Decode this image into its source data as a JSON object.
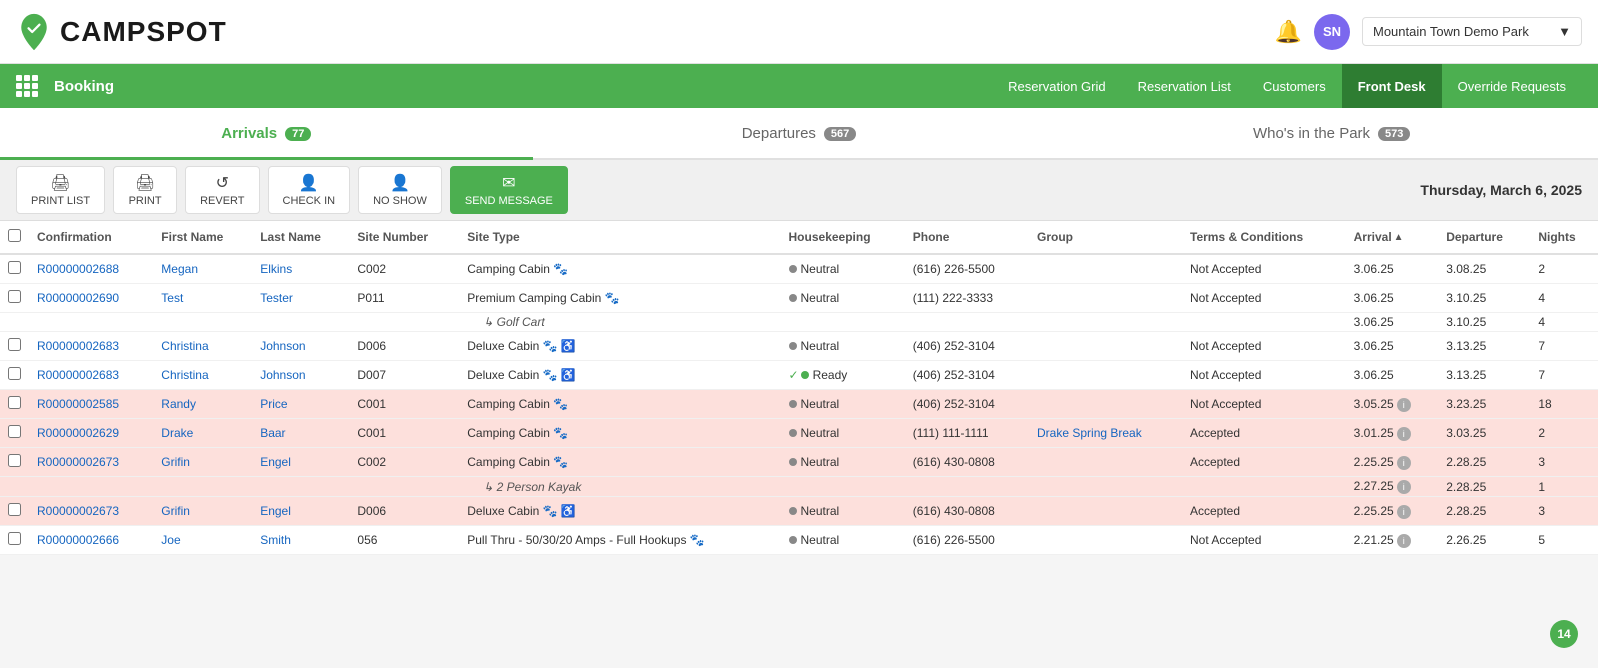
{
  "app": {
    "logo_text": "CAMPSPOT",
    "park_name": "Mountain Town Demo Park"
  },
  "nav": {
    "booking_label": "Booking",
    "links": [
      {
        "id": "reservation-grid",
        "label": "Reservation Grid"
      },
      {
        "id": "reservation-list",
        "label": "Reservation List"
      },
      {
        "id": "customers",
        "label": "Customers"
      },
      {
        "id": "front-desk",
        "label": "Front Desk",
        "active": true
      },
      {
        "id": "override-requests",
        "label": "Override Requests"
      }
    ]
  },
  "tabs": [
    {
      "id": "arrivals",
      "label": "Arrivals",
      "badge": "77",
      "active": true
    },
    {
      "id": "departures",
      "label": "Departures",
      "badge": "567",
      "active": false
    },
    {
      "id": "whos-in-park",
      "label": "Who's in the Park",
      "badge": "573",
      "active": false
    }
  ],
  "toolbar": {
    "buttons": [
      {
        "id": "print-list",
        "label": "PRINT LIST",
        "icon": "🖨"
      },
      {
        "id": "print",
        "label": "PRINT",
        "icon": "🖨"
      },
      {
        "id": "revert",
        "label": "REVERT",
        "icon": "↺"
      },
      {
        "id": "check-in",
        "label": "CHECK IN",
        "icon": "👤"
      },
      {
        "id": "no-show",
        "label": "NO SHOW",
        "icon": "👤"
      },
      {
        "id": "send-message",
        "label": "SEND MESSAGE",
        "icon": "✉"
      }
    ],
    "date": "Thursday, March 6, 2025"
  },
  "table": {
    "columns": [
      {
        "id": "checkbox",
        "label": ""
      },
      {
        "id": "confirmation",
        "label": "Confirmation"
      },
      {
        "id": "first-name",
        "label": "First Name"
      },
      {
        "id": "last-name",
        "label": "Last Name"
      },
      {
        "id": "site-number",
        "label": "Site Number"
      },
      {
        "id": "site-type",
        "label": "Site Type"
      },
      {
        "id": "housekeeping",
        "label": "Housekeeping"
      },
      {
        "id": "phone",
        "label": "Phone"
      },
      {
        "id": "group",
        "label": "Group"
      },
      {
        "id": "terms",
        "label": "Terms & Conditions"
      },
      {
        "id": "arrival",
        "label": "Arrival",
        "sortable": true
      },
      {
        "id": "departure",
        "label": "Departure"
      },
      {
        "id": "nights",
        "label": "Nights"
      }
    ],
    "rows": [
      {
        "id": "row1",
        "confirmation": "R00000002688",
        "first_name": "Megan",
        "last_name": "Elkins",
        "site_number": "C002",
        "site_type": "Camping Cabin 🐾",
        "housekeeping_status": "Neutral",
        "housekeeping_color": "neutral",
        "phone": "(616) 226-5500",
        "group": "",
        "terms": "Not Accepted",
        "arrival": "3.06.25",
        "departure": "3.08.25",
        "nights": "2",
        "highlight": false,
        "sub_row": null
      },
      {
        "id": "row2",
        "confirmation": "R00000002690",
        "first_name": "Test",
        "last_name": "Tester",
        "site_number": "P011",
        "site_type": "Premium Camping Cabin 🐾",
        "housekeeping_status": "Neutral",
        "housekeeping_color": "neutral",
        "phone": "(111) 222-3333",
        "group": "",
        "terms": "Not Accepted",
        "arrival": "3.06.25",
        "departure": "3.10.25",
        "nights": "4",
        "highlight": false,
        "sub_row": {
          "label": "Golf Cart",
          "arrival": "3.06.25",
          "departure": "3.10.25",
          "nights": "4"
        }
      },
      {
        "id": "row3",
        "confirmation": "R00000002683",
        "first_name": "Christina",
        "last_name": "Johnson",
        "site_number": "D006",
        "site_type": "Deluxe Cabin 🐾 ♿",
        "housekeeping_status": "Neutral",
        "housekeeping_color": "neutral",
        "phone": "(406) 252-3104",
        "group": "",
        "terms": "Not Accepted",
        "arrival": "3.06.25",
        "departure": "3.13.25",
        "nights": "7",
        "highlight": false,
        "sub_row": null
      },
      {
        "id": "row4",
        "confirmation": "R00000002683",
        "first_name": "Christina",
        "last_name": "Johnson",
        "site_number": "D007",
        "site_type": "Deluxe Cabin 🐾 ♿",
        "housekeeping_status": "Ready",
        "housekeeping_color": "ready",
        "phone": "(406) 252-3104",
        "group": "",
        "terms": "Not Accepted",
        "arrival": "3.06.25",
        "departure": "3.13.25",
        "nights": "7",
        "highlight": false,
        "sub_row": null
      },
      {
        "id": "row5",
        "confirmation": "R00000002585",
        "first_name": "Randy",
        "last_name": "Price",
        "site_number": "C001",
        "site_type": "Camping Cabin 🐾",
        "housekeeping_status": "Neutral",
        "housekeeping_color": "neutral",
        "phone": "(406) 252-3104",
        "group": "",
        "terms": "Not Accepted",
        "arrival": "3.05.25",
        "arrival_info": true,
        "departure": "3.23.25",
        "nights": "18",
        "highlight": true,
        "sub_row": null
      },
      {
        "id": "row6",
        "confirmation": "R00000002629",
        "first_name": "Drake",
        "last_name": "Baar",
        "site_number": "C001",
        "site_type": "Camping Cabin 🐾",
        "housekeeping_status": "Neutral",
        "housekeeping_color": "neutral",
        "phone": "(111) 111-1111",
        "group": "Drake Spring Break",
        "terms": "Accepted",
        "arrival": "3.01.25",
        "arrival_info": true,
        "departure": "3.03.25",
        "nights": "2",
        "highlight": true,
        "sub_row": null
      },
      {
        "id": "row7",
        "confirmation": "R00000002673",
        "first_name": "Grifin",
        "last_name": "Engel",
        "site_number": "C002",
        "site_type": "Camping Cabin 🐾",
        "housekeeping_status": "Neutral",
        "housekeeping_color": "neutral",
        "phone": "(616) 430-0808",
        "group": "",
        "terms": "Accepted",
        "arrival": "2.25.25",
        "arrival_info": true,
        "departure": "2.28.25",
        "nights": "3",
        "highlight": true,
        "sub_row": {
          "label": "2 Person Kayak",
          "arrival": "2.27.25",
          "arrival_info": true,
          "departure": "2.28.25",
          "nights": "1"
        }
      },
      {
        "id": "row8",
        "confirmation": "R00000002673",
        "first_name": "Grifin",
        "last_name": "Engel",
        "site_number": "D006",
        "site_type": "Deluxe Cabin 🐾 ♿",
        "housekeeping_status": "Neutral",
        "housekeeping_color": "neutral",
        "phone": "(616) 430-0808",
        "group": "",
        "terms": "Accepted",
        "arrival": "2.25.25",
        "arrival_info": true,
        "departure": "2.28.25",
        "nights": "3",
        "highlight": true,
        "sub_row": null
      },
      {
        "id": "row9",
        "confirmation": "R00000002666",
        "first_name": "Joe",
        "last_name": "Smith",
        "site_number": "056",
        "site_type": "Pull Thru - 50/30/20 Amps - Full Hookups 🐾",
        "housekeeping_status": "Neutral",
        "housekeeping_color": "neutral",
        "phone": "(616) 226-5500",
        "group": "",
        "terms": "Not Accepted",
        "arrival": "2.21.25",
        "arrival_info": true,
        "departure": "2.26.25",
        "nights": "5",
        "highlight": false,
        "sub_row": null
      }
    ]
  },
  "user": {
    "initials": "SN"
  },
  "notification_count": "14"
}
